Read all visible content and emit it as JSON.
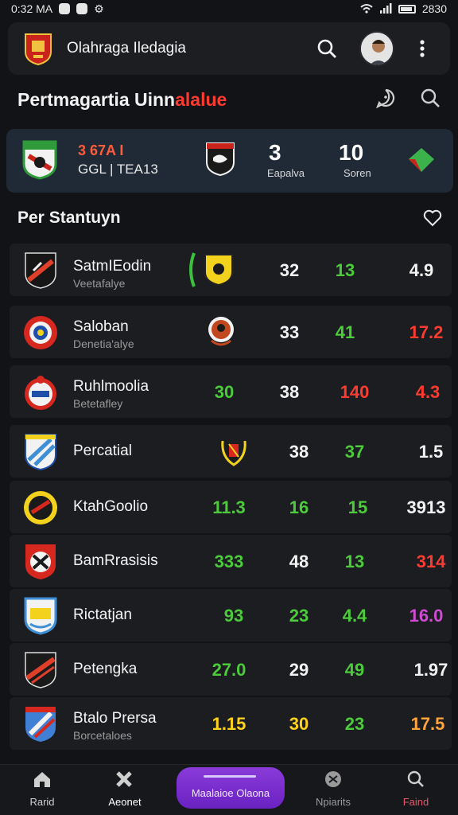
{
  "status_bar": {
    "time": "0:32 MA",
    "right_text": "2830"
  },
  "app": {
    "title": "Olahraga Iledagia"
  },
  "section": {
    "title_white": "Pertmagartia Uinn",
    "title_accent": "alalue"
  },
  "match": {
    "team1": "3 67A I",
    "team2": "GGL | TEA13",
    "score": "3",
    "score_label": "Eapalva",
    "minute": "10",
    "minute_label": "Soren"
  },
  "standings": {
    "title": "Per Stantuyn",
    "rows": [
      {
        "name": "SatmIEodin",
        "sub": "Veetafalye",
        "c1": "",
        "c2": "32",
        "c3": "13",
        "c4": "4.9"
      },
      {
        "name": "Saloban",
        "sub": "Denetia'alye",
        "c1": "",
        "c2": "33",
        "c3": "41",
        "c4": "17.2"
      },
      {
        "name": "Ruhlmoolia",
        "sub": "Betetafley",
        "c1": "30",
        "c2": "38",
        "c3": "140",
        "c4": "4.3"
      },
      {
        "name": "Percatial",
        "sub": "",
        "c1": "",
        "c2": "38",
        "c3": "37",
        "c4": "1.5"
      },
      {
        "name": "KtahGoolio",
        "sub": "",
        "c1": "11.3",
        "c2": "16",
        "c3": "15",
        "c4": "3913"
      },
      {
        "name": "BamRrasisis",
        "sub": "",
        "c1": "333",
        "c2": "48",
        "c3": "13",
        "c4": "314"
      },
      {
        "name": "Rictatjan",
        "sub": "",
        "c1": "93",
        "c2": "23",
        "c3": "4.4",
        "c4": "16.0"
      },
      {
        "name": "Petengka",
        "sub": "",
        "c1": "27.0",
        "c2": "29",
        "c3": "49",
        "c4": "1.97"
      },
      {
        "name": "Btalo Prersa",
        "sub": "Borcetaloes",
        "c1": "1.15",
        "c2": "30",
        "c3": "23",
        "c4": "17.5"
      }
    ]
  },
  "bottom_nav": {
    "home": "Rarid",
    "second": "Aeonet",
    "center": "Maalaioe Olaona",
    "fourth": "Npiarits",
    "fifth": "Faind"
  },
  "colors": {
    "accent": "#ff3b30",
    "green": "#4ccb3b",
    "purple": "#7a2fd0",
    "card": "#1f2a36"
  }
}
